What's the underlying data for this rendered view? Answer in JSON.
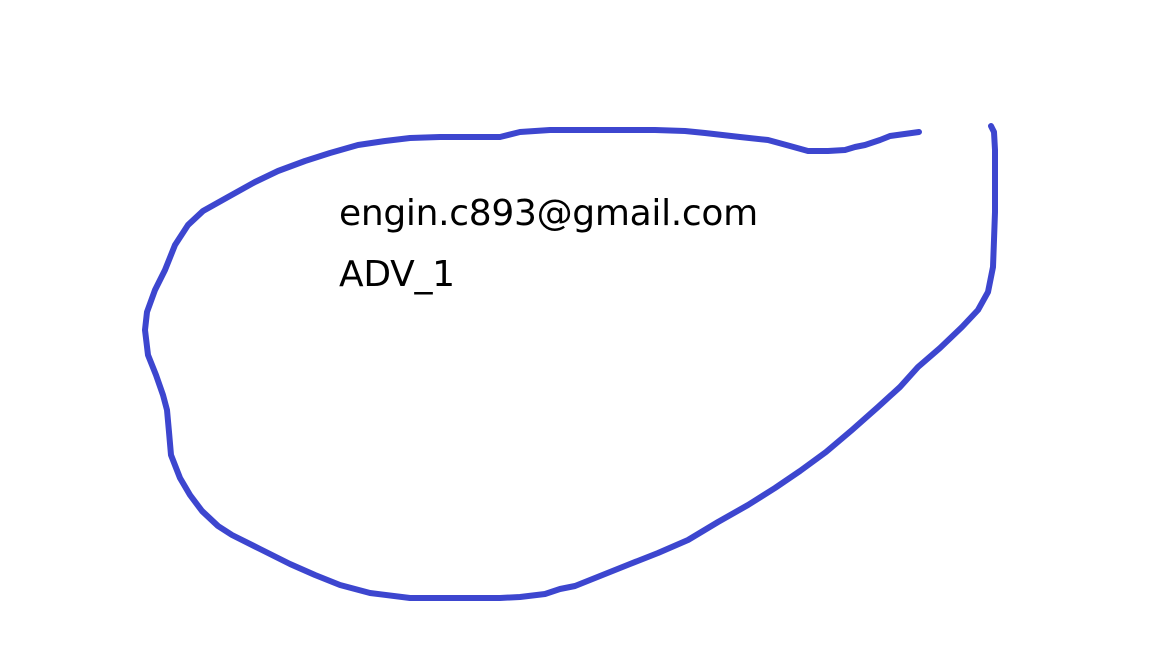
{
  "drawing": {
    "stroke_color": "#3d46cf",
    "shape": "freehand-loop",
    "background": "#ffffff"
  },
  "note": {
    "email": "engin.c893@gmail.com",
    "label": "ADV_1"
  }
}
